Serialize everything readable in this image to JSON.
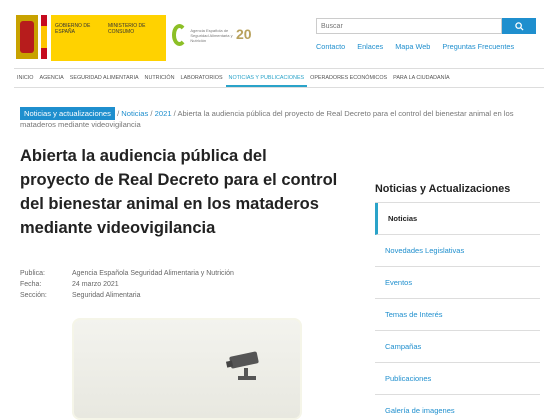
{
  "gov": {
    "line1": "Gobierno de España",
    "line2": "Ministerio de Consumo"
  },
  "aesan": {
    "text": "Agencia Española de Seguridad Alimentaria y Nutrición",
    "anniversary": "20"
  },
  "search": {
    "placeholder": "Buscar",
    "button_icon": "search-icon"
  },
  "toplinks": [
    "Contacto",
    "Enlaces",
    "Mapa Web",
    "Preguntas Frecuentes"
  ],
  "nav": [
    "Inicio",
    "Agencia",
    "Seguridad Alimentaria",
    "Nutrición",
    "Laboratorios",
    "Noticias y publicaciones",
    "Operadores económicos",
    "Para la ciudadanía"
  ],
  "nav_active_index": 5,
  "breadcrumb": {
    "home": "Noticias y actualizaciones",
    "items": [
      "Noticias",
      "2021"
    ],
    "current": "Abierta la audiencia pública del proyecto de Real Decreto para el control del bienestar animal en los mataderos mediante videovigilancia"
  },
  "title": "Abierta la audiencia pública del proyecto de Real Decreto para el control del bienestar animal en los mataderos mediante videovigilancia",
  "meta": [
    {
      "key": "Publica:",
      "value": "Agencia Española Seguridad Alimentaria y Nutrición"
    },
    {
      "key": "Fecha:",
      "value": "24 marzo 2021"
    },
    {
      "key": "Sección:",
      "value": "Seguridad Alimentaria"
    }
  ],
  "sidebar": {
    "title": "Noticias y Actualizaciones",
    "items": [
      "Noticias",
      "Novedades Legislativas",
      "Eventos",
      "Temas de Interés",
      "Campañas",
      "Publicaciones",
      "Galería de imagenes"
    ],
    "active_index": 0
  },
  "colors": {
    "accent": "#1f8fce",
    "nav_active": "#2aa3c9",
    "gov_yellow": "#ffd200",
    "aesan_green": "#8cbf26"
  }
}
